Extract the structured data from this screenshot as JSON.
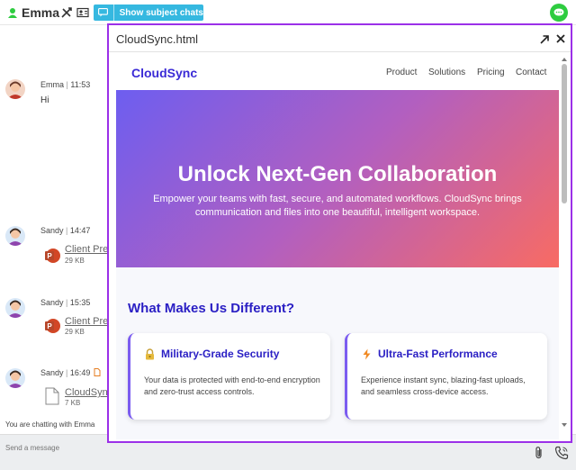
{
  "header": {
    "user_name": "Emma",
    "subject_button_label": "Show subject chats"
  },
  "messages": [
    {
      "sender": "Emma",
      "time": "11:53",
      "text": "Hi"
    },
    {
      "sender": "Sandy",
      "time": "14:47",
      "file_name": "Client Pres",
      "file_size": "29 KB",
      "file_type": "powerpoint"
    },
    {
      "sender": "Sandy",
      "time": "15:35",
      "file_name": "Client Pres",
      "file_size": "29 KB",
      "file_type": "powerpoint"
    },
    {
      "sender": "Sandy",
      "time": "16:49",
      "file_name": "CloudSync",
      "file_size": "7 KB",
      "file_type": "document"
    }
  ],
  "chatting_with_prefix": "You are chatting with",
  "chatting_with_name": "Emma",
  "composer": {
    "placeholder": "Send a message"
  },
  "preview": {
    "title": "CloudSync.html",
    "site": {
      "brand": "CloudSync",
      "nav": [
        "Product",
        "Solutions",
        "Pricing",
        "Contact"
      ],
      "hero_title": "Unlock Next-Gen Collaboration",
      "hero_subtitle": "Empower your teams with fast, secure, and automated workflows. CloudSync brings communication and files into one beautiful, intelligent workspace.",
      "section_title": "What Makes Us Different?",
      "features": [
        {
          "icon": "lock-icon",
          "title": "Military-Grade Security",
          "text": "Your data is protected with end-to-end encryption and zero-trust access controls."
        },
        {
          "icon": "lightning-icon",
          "title": "Ultra-Fast Performance",
          "text": "Experience instant sync, blazing-fast uploads, and seamless cross-device access."
        }
      ]
    }
  },
  "colors": {
    "accent_purple": "#9b30e8",
    "brand_blue": "#3b2bd6",
    "subject_button": "#35b8e0",
    "status_green": "#2ecc40",
    "powerpoint_red": "#d24726"
  }
}
